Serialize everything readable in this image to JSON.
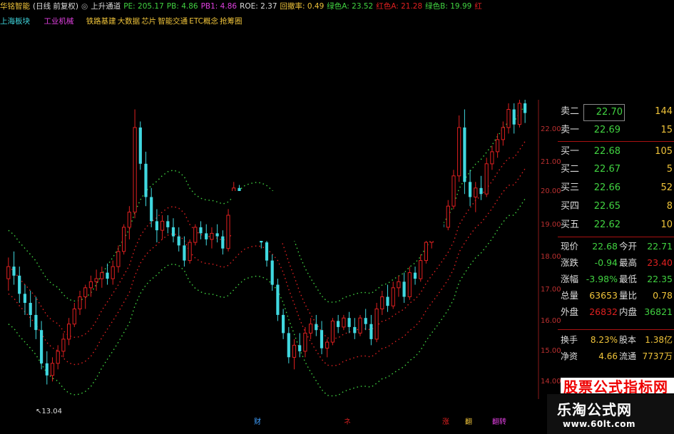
{
  "header": {
    "stock_name": "华铭智能",
    "period": "(日线 前复权)",
    "indicator": "上升通道",
    "pe": "PE: 205.17",
    "pb": "PB: 4.86",
    "pb1": "PB1: 4.86",
    "roe": "ROE: 2.37",
    "retrace": "回撤率: 0.49",
    "green_a": "绿色A: 23.52",
    "red_a": "红色A: 21.28",
    "green_b": "绿色B: 19.99",
    "red_tail": "红"
  },
  "sectors": {
    "region": "上海板块",
    "industry": "工业机械",
    "concepts": [
      "铁路基建",
      "大数据",
      "芯片",
      "智能交通",
      "ETC概念",
      "抢筹圈"
    ]
  },
  "order_book": {
    "asks": [
      {
        "label": "卖二",
        "price": "22.70",
        "vol": "144"
      },
      {
        "label": "卖一",
        "price": "22.69",
        "vol": "15"
      }
    ],
    "bids": [
      {
        "label": "买一",
        "price": "22.68",
        "vol": "105"
      },
      {
        "label": "买二",
        "price": "22.67",
        "vol": "5"
      },
      {
        "label": "买三",
        "price": "22.66",
        "vol": "52"
      },
      {
        "label": "买四",
        "price": "22.65",
        "vol": "8"
      },
      {
        "label": "买五",
        "price": "22.62",
        "vol": "10"
      }
    ]
  },
  "stats": [
    {
      "l1": "现价",
      "v1": "22.68",
      "l2": "今开",
      "v2": "22.71"
    },
    {
      "l1": "涨跌",
      "v1": "-0.94",
      "l2": "最高",
      "v2": "23.40"
    },
    {
      "l1": "涨幅",
      "v1": "-3.98%",
      "l2": "最低",
      "v2": "22.35"
    },
    {
      "l1": "总量",
      "v1": "63653",
      "l2": "量比",
      "v2": "0.78"
    },
    {
      "l1": "外盘",
      "v1": "26832",
      "l2": "内盘",
      "v2": "36821"
    }
  ],
  "stats2": [
    {
      "l1": "换手",
      "v1": "8.23%",
      "l2": "股本",
      "v2": "1.38亿"
    },
    {
      "l1": "净资",
      "v1": "4.66",
      "l2": "流通",
      "v2": "7737万"
    }
  ],
  "price_axis": [
    "22.00",
    "21.00",
    "20.00",
    "19.00",
    "18.00",
    "17.00",
    "16.00",
    "15.00",
    "14.00"
  ],
  "low_annotation": "13.04",
  "events": [
    "财",
    "ネ",
    "涨",
    "翻",
    "翻转"
  ],
  "watermark": {
    "banner": "股票公式指标网",
    "name": "乐淘公式网",
    "url": "www.60lt.com"
  },
  "colors": {
    "up": "#e02020",
    "down": "#40d8e0",
    "green": "#41d341",
    "yellow": "#f0c43a",
    "magenta": "#e040e0"
  },
  "chart_data": {
    "type": "candlestick",
    "ylim": [
      13.5,
      23.0
    ],
    "candles": [
      [
        17.2,
        17.9,
        16.8,
        17.6
      ],
      [
        17.6,
        18.1,
        17.0,
        17.3
      ],
      [
        17.3,
        17.6,
        16.4,
        16.7
      ],
      [
        16.7,
        17.0,
        16.0,
        16.4
      ],
      [
        16.4,
        16.8,
        15.6,
        16.0
      ],
      [
        16.0,
        16.6,
        15.2,
        15.5
      ],
      [
        15.5,
        15.8,
        14.2,
        14.4
      ],
      [
        14.4,
        14.8,
        13.7,
        14.0
      ],
      [
        14.0,
        14.6,
        13.8,
        14.4
      ],
      [
        14.4,
        15.0,
        14.2,
        14.8
      ],
      [
        14.8,
        15.4,
        14.6,
        15.2
      ],
      [
        15.2,
        15.9,
        15.0,
        15.7
      ],
      [
        15.7,
        16.4,
        15.6,
        16.2
      ],
      [
        16.2,
        16.8,
        16.0,
        16.6
      ],
      [
        16.6,
        17.0,
        16.2,
        16.9
      ],
      [
        16.9,
        17.3,
        16.6,
        17.1
      ],
      [
        17.1,
        17.5,
        16.8,
        17.2
      ],
      [
        17.2,
        17.6,
        16.9,
        17.4
      ],
      [
        17.4,
        17.7,
        17.0,
        17.2
      ],
      [
        17.2,
        17.8,
        17.0,
        17.6
      ],
      [
        17.6,
        18.3,
        17.4,
        18.1
      ],
      [
        18.1,
        19.0,
        18.0,
        18.9
      ],
      [
        18.9,
        19.6,
        18.5,
        19.4
      ],
      [
        19.4,
        22.8,
        19.2,
        22.2
      ],
      [
        22.2,
        22.4,
        20.8,
        21.0
      ],
      [
        21.0,
        21.4,
        19.6,
        19.9
      ],
      [
        19.9,
        20.2,
        18.9,
        19.1
      ],
      [
        19.1,
        19.5,
        18.4,
        18.8
      ],
      [
        18.8,
        19.3,
        18.5,
        19.1
      ],
      [
        19.1,
        19.3,
        18.7,
        18.9
      ],
      [
        18.9,
        19.2,
        18.4,
        18.6
      ],
      [
        18.6,
        18.9,
        18.1,
        18.3
      ],
      [
        18.3,
        18.6,
        17.6,
        17.8
      ],
      [
        17.8,
        18.5,
        17.7,
        18.4
      ],
      [
        18.4,
        19.0,
        18.3,
        18.9
      ],
      [
        18.9,
        19.1,
        18.5,
        18.7
      ],
      [
        18.7,
        19.0,
        18.3,
        18.5
      ],
      [
        18.5,
        18.9,
        18.2,
        18.7
      ],
      [
        18.7,
        19.0,
        18.4,
        18.6
      ],
      [
        18.6,
        18.8,
        18.0,
        18.2
      ],
      [
        18.2,
        19.5,
        18.1,
        19.3
      ],
      [
        19.3,
        20.4,
        19.1,
        20.2
      ],
      [
        20.2,
        20.3,
        19.6,
        19.8
      ],
      [
        19.8,
        20.1,
        19.5,
        19.9
      ],
      [
        19.9,
        20.0,
        19.4,
        19.6
      ],
      [
        19.6,
        19.8,
        18.9,
        19.0
      ],
      [
        19.0,
        19.2,
        18.2,
        18.4
      ],
      [
        18.4,
        18.6,
        17.6,
        17.8
      ],
      [
        17.8,
        18.0,
        16.8,
        17.0
      ],
      [
        17.0,
        17.2,
        15.8,
        16.0
      ],
      [
        16.0,
        16.2,
        15.2,
        15.4
      ],
      [
        15.4,
        15.6,
        14.4,
        14.6
      ],
      [
        14.6,
        15.2,
        14.2,
        15.0
      ],
      [
        15.0,
        15.4,
        14.6,
        14.8
      ],
      [
        14.8,
        15.6,
        14.6,
        15.4
      ],
      [
        15.4,
        15.9,
        15.2,
        15.7
      ],
      [
        15.7,
        16.0,
        15.3,
        15.5
      ],
      [
        15.5,
        15.8,
        14.7,
        14.9
      ],
      [
        14.9,
        15.2,
        14.6,
        15.1
      ],
      [
        15.1,
        15.9,
        15.0,
        15.8
      ],
      [
        15.8,
        16.0,
        15.4,
        15.6
      ],
      [
        15.6,
        16.0,
        15.5,
        15.9
      ],
      [
        15.9,
        16.1,
        15.4,
        15.6
      ],
      [
        15.6,
        15.9,
        15.2,
        15.4
      ],
      [
        15.4,
        16.0,
        15.3,
        15.9
      ],
      [
        15.9,
        16.2,
        15.5,
        15.7
      ],
      [
        15.7,
        16.0,
        15.0,
        15.2
      ],
      [
        15.2,
        16.4,
        15.1,
        16.2
      ],
      [
        16.2,
        16.8,
        16.0,
        16.6
      ],
      [
        16.6,
        17.0,
        16.1,
        16.3
      ],
      [
        16.3,
        17.1,
        16.2,
        16.9
      ],
      [
        16.9,
        17.3,
        16.6,
        17.1
      ],
      [
        17.1,
        17.4,
        16.4,
        16.6
      ],
      [
        16.6,
        17.6,
        16.5,
        17.4
      ],
      [
        17.4,
        17.6,
        17.0,
        17.2
      ],
      [
        17.2,
        18.0,
        17.1,
        17.8
      ],
      [
        17.8,
        18.6,
        17.7,
        18.4
      ],
      [
        18.4,
        18.9,
        18.2,
        18.7
      ],
      [
        18.7,
        19.2,
        18.5,
        19.0
      ],
      [
        19.0,
        19.4,
        18.6,
        18.9
      ],
      [
        18.9,
        19.8,
        18.8,
        19.6
      ],
      [
        19.6,
        20.8,
        19.5,
        20.6
      ],
      [
        20.6,
        22.6,
        20.4,
        22.2
      ],
      [
        22.2,
        22.8,
        20.0,
        20.4
      ],
      [
        20.4,
        20.8,
        19.6,
        19.9
      ],
      [
        19.9,
        20.4,
        19.4,
        20.2
      ],
      [
        20.2,
        20.6,
        19.8,
        20.0
      ],
      [
        20.0,
        21.2,
        19.9,
        21.0
      ],
      [
        21.0,
        21.6,
        20.8,
        21.4
      ],
      [
        21.4,
        22.0,
        21.2,
        21.8
      ],
      [
        21.8,
        22.4,
        21.6,
        22.2
      ],
      [
        22.2,
        23.0,
        22.0,
        22.8
      ],
      [
        22.8,
        23.0,
        22.0,
        22.3
      ],
      [
        22.3,
        23.2,
        22.2,
        23.0
      ],
      [
        23.0,
        23.4,
        22.35,
        22.68
      ]
    ]
  }
}
